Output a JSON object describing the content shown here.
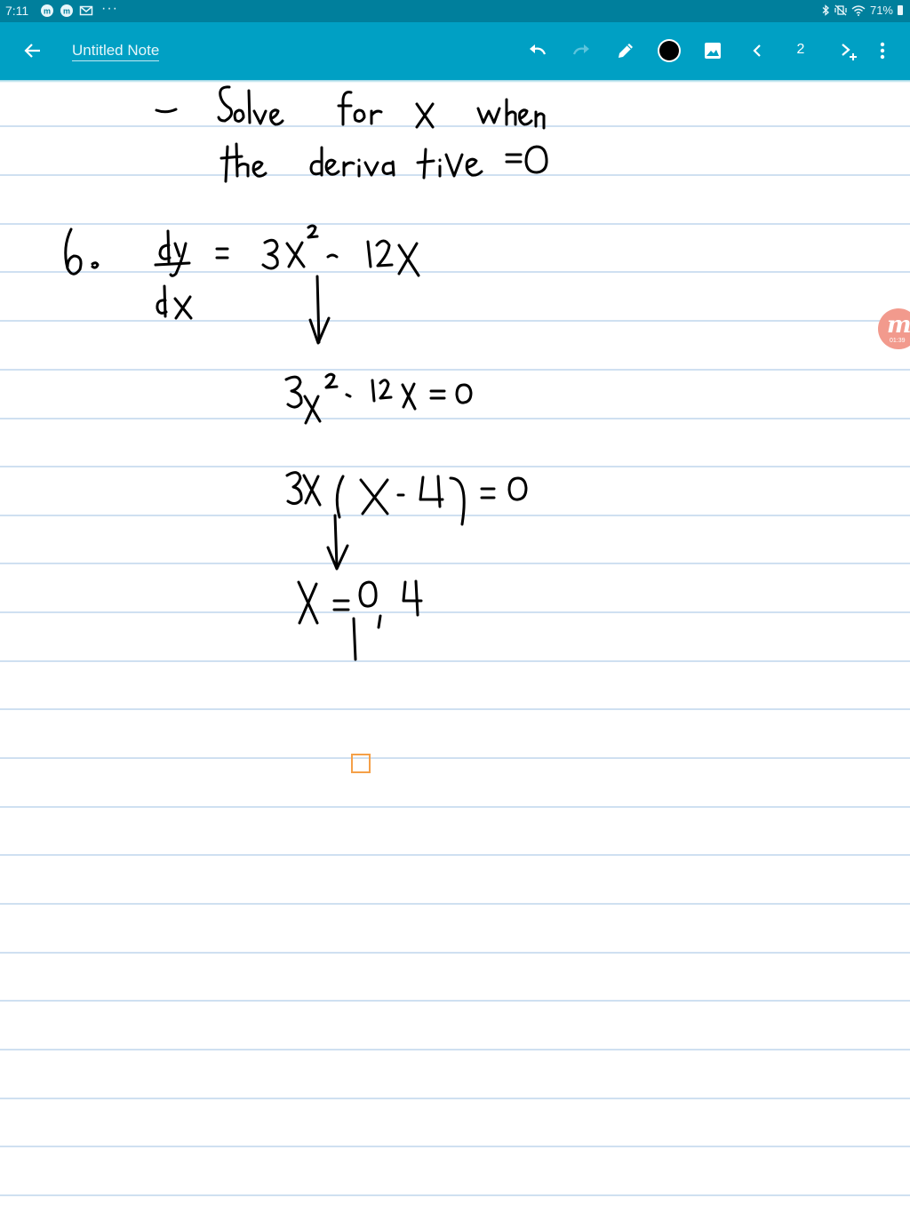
{
  "status_bar": {
    "time": "7:11",
    "dots": "···",
    "battery_percent": "71%",
    "icons": [
      "bluetooth-icon",
      "vibrate-mute-icon",
      "wifi-icon",
      "battery-icon"
    ]
  },
  "app_bar": {
    "note_title": "Untitled Note",
    "page_number": "2",
    "pen_color": "#000000",
    "icons": [
      "back-arrow-icon",
      "undo-icon",
      "redo-icon",
      "pen-icon",
      "color-dot-icon",
      "image-icon",
      "previous-page-icon",
      "next-page-add-icon",
      "more-vert-icon"
    ]
  },
  "floating_badge": {
    "letter": "m",
    "time": "01:39"
  },
  "colors": {
    "status_bar": "#007f9c",
    "app_bar": "#00a0c4",
    "rule_line": "#cfe0f1",
    "ink": "#000000",
    "selection_handle": "#f5a048",
    "badge": "#f29a8d"
  },
  "note": {
    "lines": [
      "- Solve for x when",
      "the derivative = 0",
      "6. dy/dx = 3x² - 12x",
      "↓",
      "3x² - 12x = 0",
      "3x(x - 4) = 0",
      "↓",
      "x = 0, 4"
    ]
  }
}
